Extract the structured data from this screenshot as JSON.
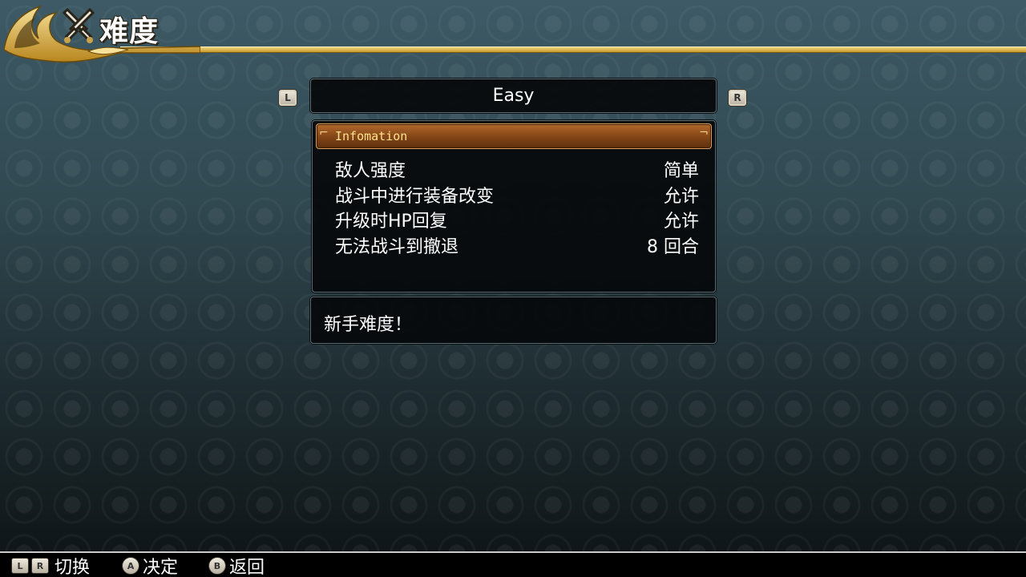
{
  "header": {
    "title": "难度",
    "icon": "crossed-swords-icon"
  },
  "difficulty": {
    "value": "Easy",
    "prev_button": "L",
    "next_button": "R"
  },
  "info": {
    "header_label": "Infomation",
    "rows": [
      {
        "label": "敌人强度",
        "value": "简单"
      },
      {
        "label": "战斗中进行装备改变",
        "value": "允许"
      },
      {
        "label": "升级时HP回复",
        "value": "允许"
      },
      {
        "label": "无法战斗到撤退",
        "value": "8 回合"
      }
    ]
  },
  "description": {
    "text": "新手难度！"
  },
  "controls": {
    "switch": {
      "keys": [
        "L",
        "R"
      ],
      "label": "切换"
    },
    "confirm": {
      "key": "A",
      "label": "决定"
    },
    "back": {
      "key": "B",
      "label": "返回"
    }
  },
  "colors": {
    "gold": "#e7c25a",
    "info_header": "#8a4a1a",
    "panel_bg": "#05080a"
  }
}
